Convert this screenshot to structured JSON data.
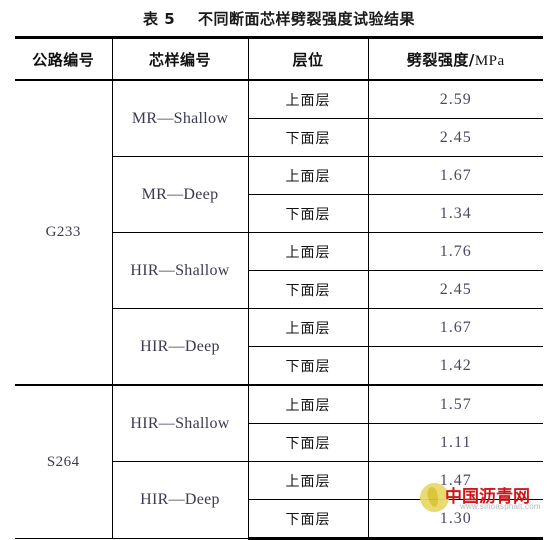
{
  "title": "表 5    不同断面芯样劈裂强度试验结果",
  "table": {
    "headers": {
      "road_no": "公路编号",
      "core_no": "芯样编号",
      "layer": "层位",
      "strength": "劈裂强度/",
      "strength_unit": "MPa"
    },
    "groups": [
      {
        "road_no": "G233",
        "cores": [
          {
            "core_no": "MR—Shallow",
            "rows": [
              {
                "layer": "上面层",
                "value": "2.59"
              },
              {
                "layer": "下面层",
                "value": "2.45"
              }
            ]
          },
          {
            "core_no": "MR—Deep",
            "rows": [
              {
                "layer": "上面层",
                "value": "1.67"
              },
              {
                "layer": "下面层",
                "value": "1.34"
              }
            ]
          },
          {
            "core_no": "HIR—Shallow",
            "rows": [
              {
                "layer": "上面层",
                "value": "1.76"
              },
              {
                "layer": "下面层",
                "value": "2.45"
              }
            ]
          },
          {
            "core_no": "HIR—Deep",
            "rows": [
              {
                "layer": "上面层",
                "value": "1.67"
              },
              {
                "layer": "下面层",
                "value": "1.42"
              }
            ]
          }
        ]
      },
      {
        "road_no": "S264",
        "cores": [
          {
            "core_no": "HIR—Shallow",
            "rows": [
              {
                "layer": "上面层",
                "value": "1.57"
              },
              {
                "layer": "下面层",
                "value": "1.11"
              }
            ]
          },
          {
            "core_no": "HIR—Deep",
            "rows": [
              {
                "layer": "上面层",
                "value": "1.47"
              },
              {
                "layer": "下面层",
                "value": "1.30"
              }
            ]
          }
        ]
      }
    ]
  },
  "watermark": {
    "cn_text": "中国沥青网",
    "url_text": "www.sinoasphalt.com"
  },
  "colors": {
    "rule": "#000000",
    "value_text": "#4a4a62",
    "watermark_red": "#d0181c",
    "watermark_yellow": "#e8d96a"
  }
}
